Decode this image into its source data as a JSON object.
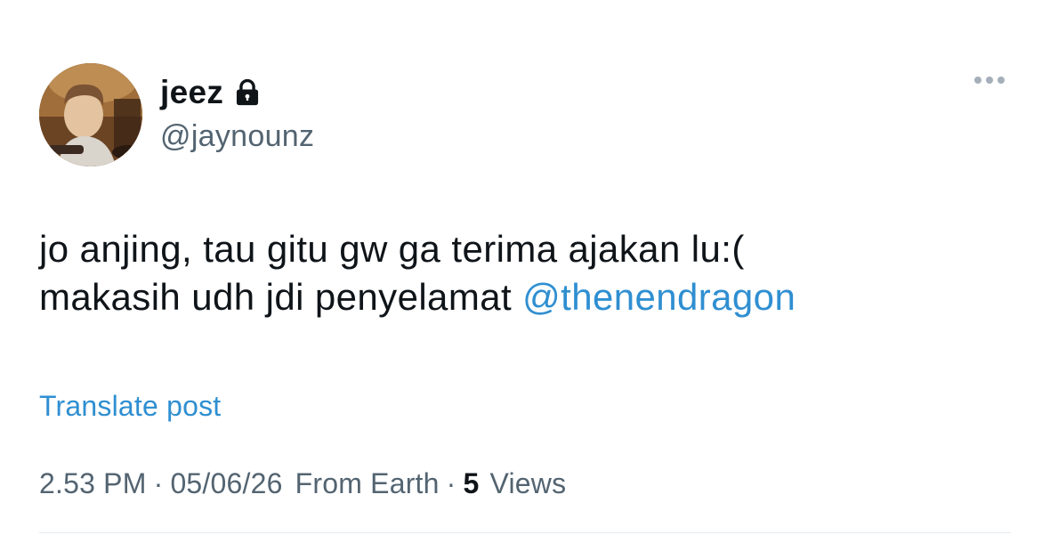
{
  "author": {
    "display_name": "jeez",
    "handle": "@jaynounz",
    "avatar_icon": "avatar-photo",
    "protected_icon": "lock-icon"
  },
  "more_icon": "more-options-icon",
  "tweet": {
    "line1": "jo anjing, tau gitu gw ga terima ajakan lu:(",
    "line2_text": "makasih udh jdi penyelamat",
    "mention": "@thenendragon"
  },
  "translate_label": "Translate post",
  "meta": {
    "time": "2.53 PM",
    "separator": "·",
    "date": "05/06/26",
    "source": "From Earth",
    "views_count": "5",
    "views_label": "Views"
  },
  "colors": {
    "link": "#2f8fd1",
    "secondary_text": "#536471",
    "primary_text": "#0f1419"
  }
}
